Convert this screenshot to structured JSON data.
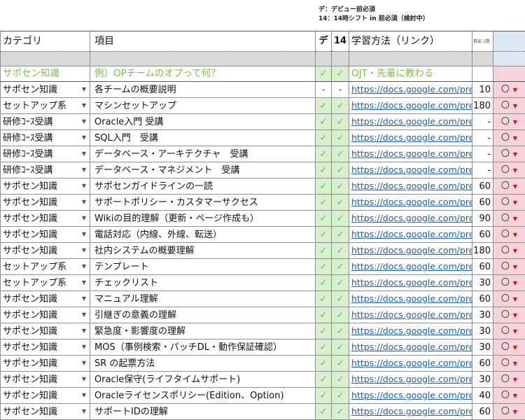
{
  "notes": {
    "line1": "デ：デビュー前必須",
    "line2": "14：14時シフト in 前必須（検討中）"
  },
  "header": {
    "category": "カテゴリ",
    "item": "項目",
    "de": "デ",
    "h14": "14",
    "method": "学習方法（リンク）",
    "target": "目安\n1数"
  },
  "example": {
    "category": "サポセン知識",
    "item": "例）OPチームのオプって何？",
    "de": "✓",
    "h14": "✓",
    "method": "OJT・先輩に教わる"
  },
  "rows": [
    {
      "category": "サポセン知識",
      "item": "各チームの概要説明",
      "de": "-",
      "h14": "-",
      "link": "https://docs.google.com/pre",
      "num": "10",
      "status": "〇"
    },
    {
      "category": "セットアップ系",
      "item": "マシンセットアップ",
      "de": "✓",
      "h14": "✓",
      "link": "https://docs.google.com/pre",
      "num": "180",
      "status": "〇"
    },
    {
      "category": "研修ｺｰｽ受講",
      "item": "Oracle入門 受講",
      "de": "✓",
      "h14": "✓",
      "link": "https://docs.google.com/pre",
      "num": "-",
      "status": "〇"
    },
    {
      "category": "研修ｺｰｽ受講",
      "item": "SQL入門　受講",
      "de": "✓",
      "h14": "✓",
      "link": "https://docs.google.com/pre",
      "num": "-",
      "status": "〇"
    },
    {
      "category": "研修ｺｰｽ受講",
      "item": "データベース・アーキテクチャ　受講",
      "de": "✓",
      "h14": "✓",
      "link": "https://docs.google.com/pre",
      "num": "-",
      "status": "〇"
    },
    {
      "category": "研修ｺｰｽ受講",
      "item": "データベース・マネジメント　受講",
      "de": "✓",
      "h14": "✓",
      "link": "https://docs.google.com/pre",
      "num": "-",
      "status": "〇"
    },
    {
      "category": "サポセン知識",
      "item": "サポセンガイドラインの一読",
      "de": "✓",
      "h14": "✓",
      "link": "https://docs.google.com/pre",
      "num": "60",
      "status": "〇"
    },
    {
      "category": "サポセン知識",
      "item": "サポートポリシー・カスタマーサクセス",
      "de": "✓",
      "h14": "✓",
      "link": "https://docs.google.com/pre",
      "num": "60",
      "status": "〇"
    },
    {
      "category": "サポセン知識",
      "item": "Wikiの目的理解（更新・ページ作成も）",
      "de": "✓",
      "h14": "✓",
      "link": "https://docs.google.com/pre",
      "num": "90",
      "status": "〇"
    },
    {
      "category": "サポセン知識",
      "item": "電話対応（内線、外線、転送）",
      "de": "✓",
      "h14": "✓",
      "link": "https://docs.google.com/pre",
      "num": "60",
      "status": "〇"
    },
    {
      "category": "サポセン知識",
      "item": "社内システムの概要理解",
      "de": "✓",
      "h14": "✓",
      "link": "https://docs.google.com/pre",
      "num": "180",
      "status": "〇"
    },
    {
      "category": "セットアップ系",
      "item": "テンプレート",
      "de": "✓",
      "h14": "✓",
      "link": "https://docs.google.com/pre",
      "num": "60",
      "status": "〇"
    },
    {
      "category": "セットアップ系",
      "item": "チェックリスト",
      "de": "✓",
      "h14": "✓",
      "link": "https://docs.google.com/pre",
      "num": "30",
      "status": "〇"
    },
    {
      "category": "サポセン知識",
      "item": "マニュアル理解",
      "de": "✓",
      "h14": "✓",
      "link": "https://docs.google.com/pre",
      "num": "60",
      "status": "〇"
    },
    {
      "category": "サポセン知識",
      "item": "引継ぎの意義の理解",
      "de": "✓",
      "h14": "✓",
      "link": "https://docs.google.com/pre",
      "num": "30",
      "status": "〇"
    },
    {
      "category": "サポセン知識",
      "item": "緊急度・影響度の理解",
      "de": "✓",
      "h14": "✓",
      "link": "https://docs.google.com/pre",
      "num": "30",
      "status": "〇"
    },
    {
      "category": "サポセン知識",
      "item": "MOS（事例検索・パッチDL・動作保証確認）",
      "de": "✓",
      "h14": "✓",
      "link": "https://docs.google.com/pre",
      "num": "30",
      "status": "〇"
    },
    {
      "category": "サポセン知識",
      "item": "SR の起票方法",
      "de": "✓",
      "h14": "✓",
      "link": "https://docs.google.com/pre",
      "num": "60",
      "status": "〇"
    },
    {
      "category": "サポセン知識",
      "item": "Oracle保守(ライフタイムサポート)",
      "de": "✓",
      "h14": "✓",
      "link": "https://docs.google.com/pre",
      "num": "30",
      "status": "〇"
    },
    {
      "category": "サポセン知識",
      "item": "Oracleライセンスポリシー(Edition、Option)",
      "de": "✓",
      "h14": "✓",
      "link": "https://docs.google.com/pre",
      "num": "40",
      "status": "〇"
    },
    {
      "category": "サポセン知識",
      "item": "サポートIDの理解",
      "de": "✓",
      "h14": "✓",
      "link": "https://docs.google.com/pre",
      "num": "60",
      "status": "〇"
    }
  ]
}
